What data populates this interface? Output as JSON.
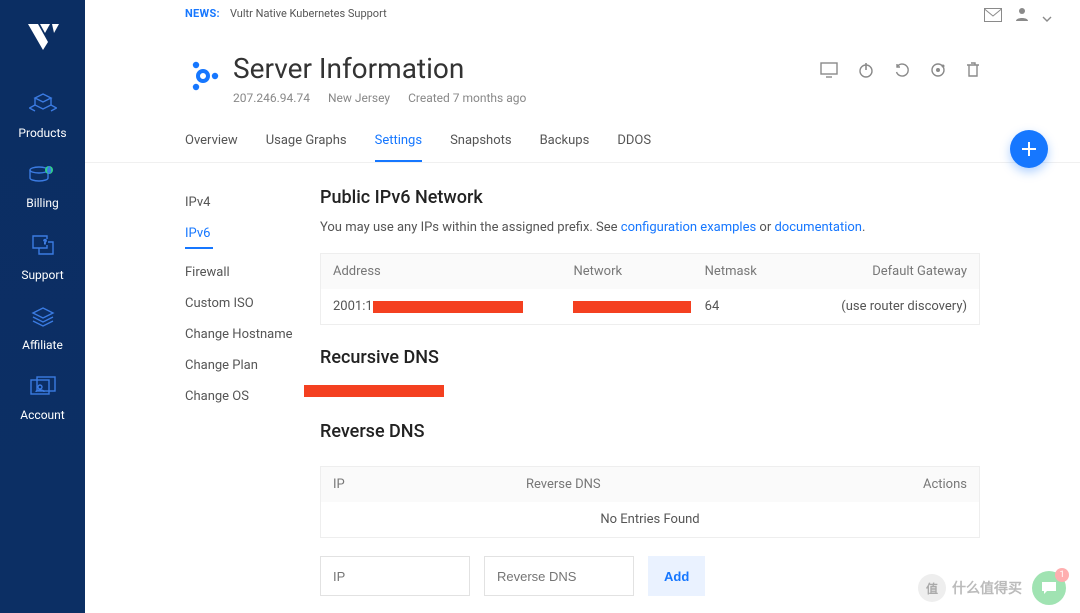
{
  "news": {
    "label": "NEWS:",
    "text": "Vultr Native Kubernetes Support"
  },
  "sidebar": {
    "items": [
      {
        "label": "Products"
      },
      {
        "label": "Billing"
      },
      {
        "label": "Support"
      },
      {
        "label": "Affiliate"
      },
      {
        "label": "Account"
      }
    ]
  },
  "header": {
    "title": "Server Information",
    "ip": "207.246.94.74",
    "location": "New Jersey",
    "created": "Created 7 months ago"
  },
  "tabs": [
    "Overview",
    "Usage Graphs",
    "Settings",
    "Snapshots",
    "Backups",
    "DDOS"
  ],
  "active_tab": "Settings",
  "subnav": [
    "IPv4",
    "IPv6",
    "Firewall",
    "Custom ISO",
    "Change Hostname",
    "Change Plan",
    "Change OS"
  ],
  "active_sub": "IPv6",
  "ipv6": {
    "title": "Public IPv6 Network",
    "subtext_pre": "You may use any IPs within the assigned prefix. See ",
    "link1": "configuration examples",
    "or": " or ",
    "link2": "documentation",
    "period": ".",
    "cols": {
      "address": "Address",
      "network": "Network",
      "netmask": "Netmask",
      "gateway": "Default Gateway"
    },
    "row": {
      "address_prefix": "2001:1",
      "netmask": "64",
      "gateway": "(use router discovery)"
    }
  },
  "rdns_title": "Recursive DNS",
  "reverse": {
    "title": "Reverse DNS",
    "cols": {
      "ip": "IP",
      "rd": "Reverse DNS",
      "actions": "Actions"
    },
    "empty": "No Entries Found",
    "placeholders": {
      "ip": "IP",
      "rd": "Reverse DNS"
    },
    "add": "Add"
  },
  "watermark": "什么值得买",
  "chat_badge": "1"
}
